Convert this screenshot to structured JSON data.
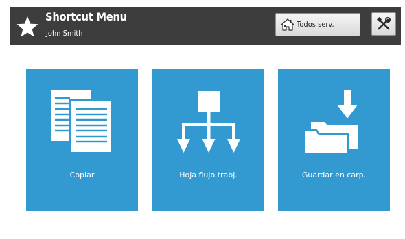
{
  "header": {
    "title": "Shortcut Menu",
    "user_name": "John Smith",
    "star_icon": "star-icon",
    "all_services": {
      "label": "Todos serv.",
      "icon": "house-icon"
    },
    "tools": {
      "icon": "tools-icon"
    }
  },
  "tiles": [
    {
      "label": "Copiar",
      "icon": "copy-documents-icon"
    },
    {
      "label": "Hoja flujo trabj.",
      "icon": "workflow-tree-icon"
    },
    {
      "label": "Guardar en carp.",
      "icon": "folder-download-icon"
    }
  ],
  "colors": {
    "header_bg": "#3d3d3d",
    "tile_bg": "#3399d1",
    "button_bg": "#e6e6e6",
    "text_on_dark": "#ffffff"
  }
}
